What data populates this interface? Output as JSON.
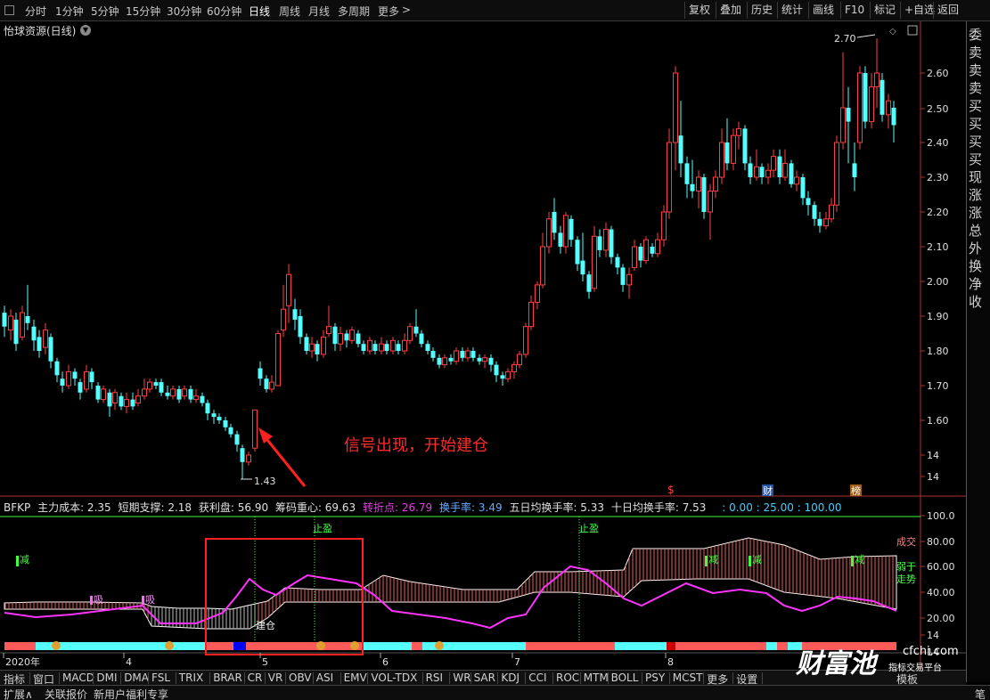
{
  "toolbar": {
    "periods": [
      "分时",
      "1分钟",
      "5分钟",
      "15分钟",
      "30分钟",
      "60分钟",
      "日线",
      "周线",
      "月线",
      "多周期",
      "更多"
    ],
    "more_glyph": ">",
    "buttons": [
      "复权",
      "叠加",
      "历史",
      "统计",
      "画线",
      "F10",
      "标记",
      "+自选",
      "返回"
    ]
  },
  "chart_header": {
    "title": "怡球资源(日线)"
  },
  "price_axis": [
    "2.60",
    "2.50",
    "2.40",
    "2.30",
    "2.20",
    "2.10",
    "2.00",
    "1.90",
    "1.80",
    "1.70",
    "1.60",
    "14",
    "14",
    "14"
  ],
  "annotations": {
    "high_label": "2.70",
    "low_label": "1.43",
    "signal_text": "信号出现，开始建仓",
    "event_markers": [
      "$",
      "财",
      "榜"
    ]
  },
  "indicator": {
    "name": "BFKP",
    "fields": [
      {
        "label": "主力成本: 2.35",
        "color": "#e0e0e0"
      },
      {
        "label": "短期支撑: 2.18",
        "color": "#e0e0e0"
      },
      {
        "label": "获利盘: 56.90",
        "color": "#e0e0e0"
      },
      {
        "label": "筹码重心: 69.63",
        "color": "#e0e0e0"
      },
      {
        "label": "转折点: 26.79",
        "color": "#e040e0"
      },
      {
        "label": "换手率: 3.49",
        "color": "#6af"
      },
      {
        "label": "五日均换手率: 5.33",
        "color": "#e0e0e0"
      },
      {
        "label": "十日均换手率: 7.53",
        "color": "#e0e0e0"
      },
      {
        "label": ": 0.00 : 25.00 : 100.00",
        "color": "#4cf"
      }
    ],
    "axis": [
      "100.0",
      "80.00",
      "60.00",
      "40.00",
      "20.00",
      "14",
      "14"
    ],
    "labels": {
      "stop_profit": "止盈",
      "reduce": "减",
      "absorb": "吸",
      "build": "建仓",
      "right_1": "成交",
      "right_2": "弱于",
      "right_3": "走势"
    }
  },
  "time_axis": [
    "2020年",
    "4",
    "5",
    "6",
    "7",
    "8"
  ],
  "tabs": [
    "指标",
    "窗口",
    "MACD",
    "DMI",
    "DMA",
    "FSL",
    "TRIX",
    "BRAR",
    "CR",
    "VR",
    "OBV",
    "ASI",
    "EMV",
    "VOL-TDX",
    "RSI",
    "WR",
    "SAR",
    "KDJ",
    "CCI",
    "ROC",
    "MTM",
    "BOLL",
    "PSY",
    "MCST",
    "更多",
    "设置"
  ],
  "tab_right": "模板",
  "bottom": {
    "items": [
      "扩展∧",
      "关联报价",
      "新用户福利专享"
    ],
    "right": "笔"
  },
  "side_panel": [
    "委",
    "卖",
    "卖",
    "卖",
    "买",
    "买",
    "买",
    "买",
    "现",
    "涨",
    "涨",
    "总",
    "外",
    "换",
    "净",
    "收"
  ],
  "watermark": {
    "brand": "财富池",
    "site": "cfchi.com",
    "sub": "指标交易平台"
  },
  "colors": {
    "up": "#ff4040",
    "down": "#54ffff",
    "signal": "#ff2020",
    "line": "#ff33ff",
    "box": "#ff2020"
  }
}
